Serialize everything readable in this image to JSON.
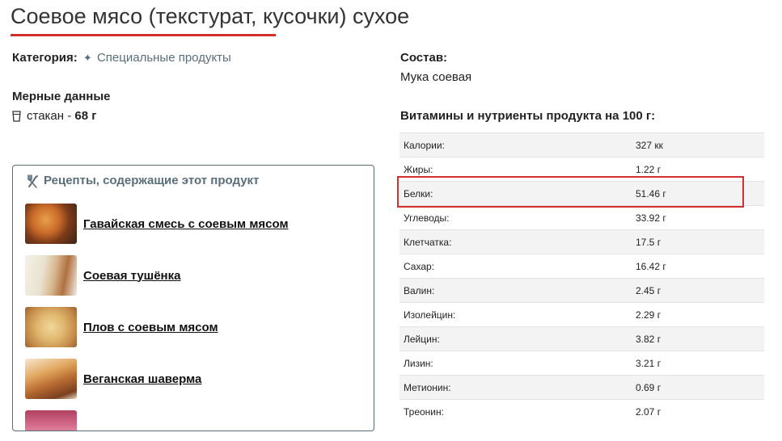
{
  "page": {
    "title": "Соевое мясо (текстурат, кусочки) сухое"
  },
  "category": {
    "label": "Категория:",
    "value": "Специальные продукты",
    "icon": "sparkle-icon"
  },
  "measures": {
    "title": "Мерные данные",
    "unit": "стакан",
    "separator": " - ",
    "amount": "68 г",
    "icon": "glass-icon"
  },
  "recipes": {
    "header": "Рецепты, содержащие этот продукт",
    "icon": "utensils-icon",
    "items": [
      {
        "title": "Гавайская смесь с соевым мясом"
      },
      {
        "title": "Соевая тушёнка"
      },
      {
        "title": "Плов с соевым мясом"
      },
      {
        "title": "Веганская шаверма"
      }
    ]
  },
  "composition": {
    "title": "Состав:",
    "value": "Мука соевая"
  },
  "nutrients": {
    "title": "Витамины и нутриенты продукта на 100 г:",
    "highlighted_row": "Белки:",
    "highlight_color": "#d32f2f",
    "rows": [
      {
        "name": "Калории:",
        "value": "327 кк"
      },
      {
        "name": "Жиры:",
        "value": "1.22 г"
      },
      {
        "name": "Белки:",
        "value": "51.46 г"
      },
      {
        "name": "Углеводы:",
        "value": "33.92 г"
      },
      {
        "name": "Клетчатка:",
        "value": "17.5 г"
      },
      {
        "name": "Сахар:",
        "value": "16.42 г"
      },
      {
        "name": "Валин:",
        "value": "2.45 г"
      },
      {
        "name": "Изолейцин:",
        "value": "2.29 г"
      },
      {
        "name": "Лейцин:",
        "value": "3.82 г"
      },
      {
        "name": "Лизин:",
        "value": "3.21 г"
      },
      {
        "name": "Метионин:",
        "value": "0.69 г"
      },
      {
        "name": "Треонин:",
        "value": "2.07 г"
      }
    ]
  },
  "colors": {
    "accent": "#d32f2f",
    "muted_link": "#5a6d7a"
  }
}
